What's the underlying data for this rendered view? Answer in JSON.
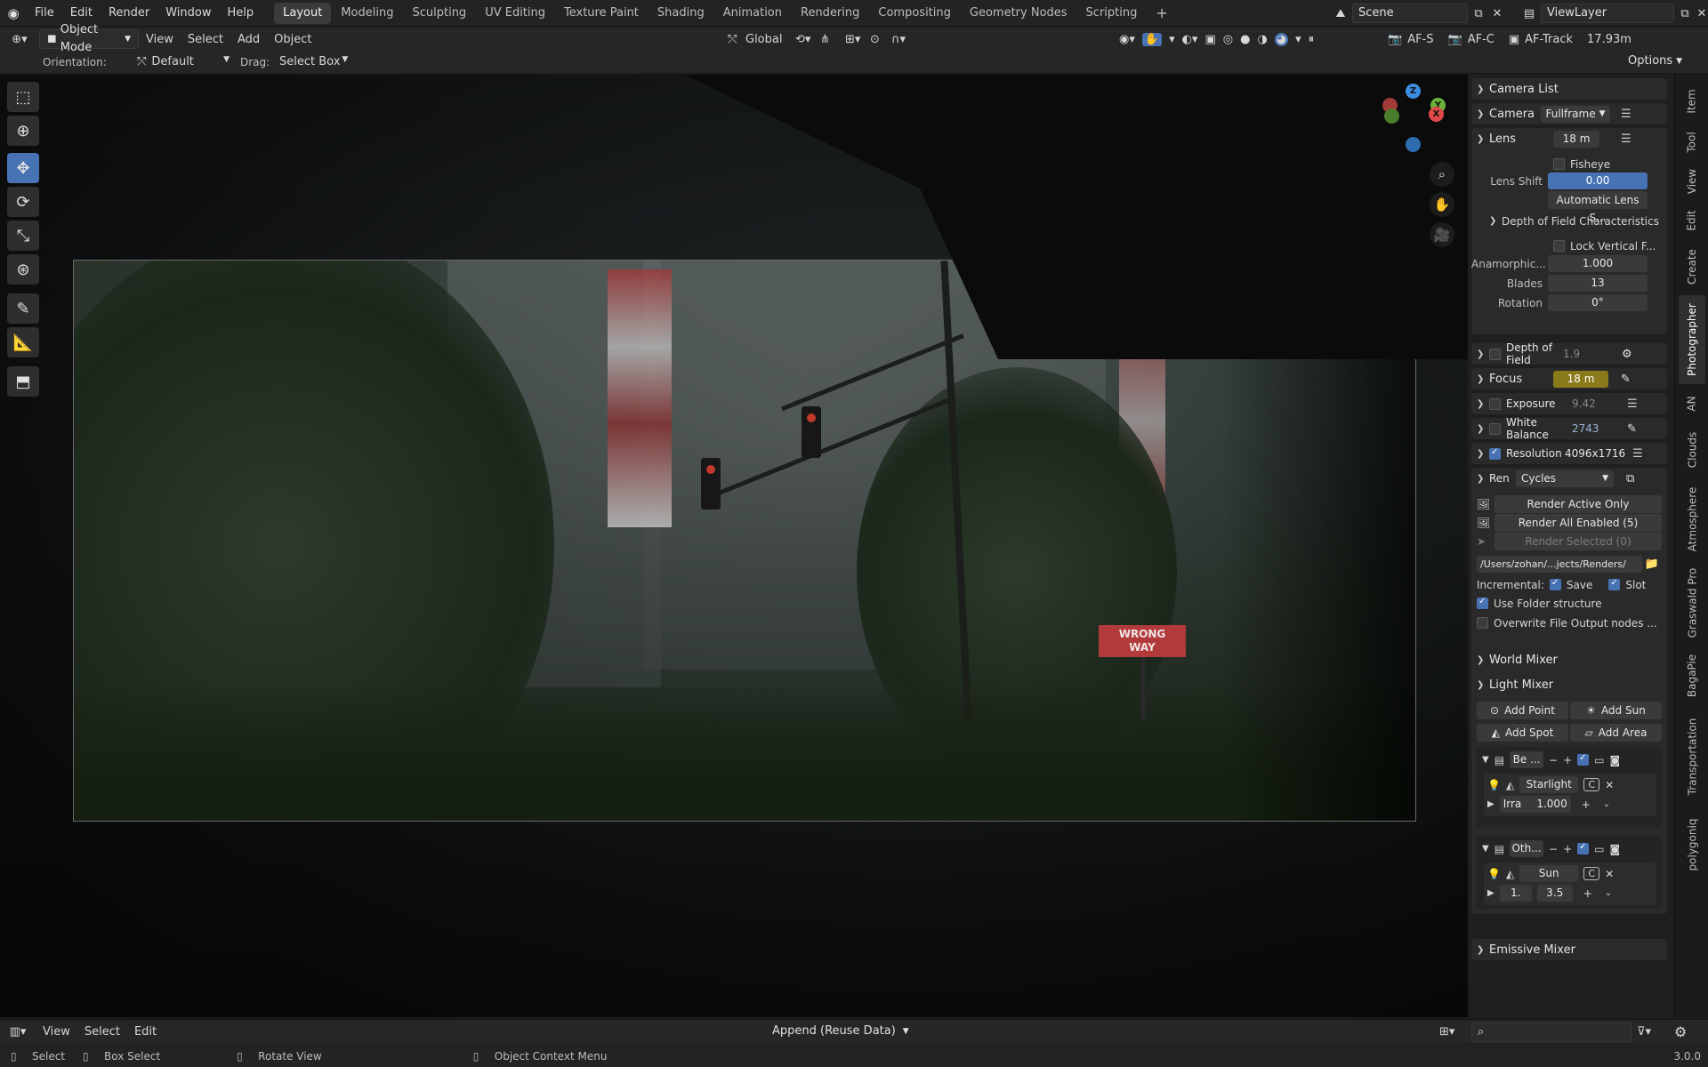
{
  "topbar": {
    "menus": [
      "File",
      "Edit",
      "Render",
      "Window",
      "Help"
    ],
    "workspaces": [
      "Layout",
      "Modeling",
      "Sculpting",
      "UV Editing",
      "Texture Paint",
      "Shading",
      "Animation",
      "Rendering",
      "Compositing",
      "Geometry Nodes",
      "Scripting"
    ],
    "active_workspace": "Layout",
    "add_workspace": "+",
    "scene_name": "Scene",
    "view_layer": "ViewLayer"
  },
  "viewport_header": {
    "mode": "Object Mode",
    "menus": [
      "View",
      "Select",
      "Add",
      "Object"
    ],
    "transform_orientation": "Global",
    "af_s": "AF-S",
    "af_c": "AF-C",
    "af_track": "AF-Track",
    "focus_distance": "17.93m"
  },
  "tool_header": {
    "orientation_label": "Orientation:",
    "orientation_value": "Default",
    "drag_label": "Drag:",
    "drag_value": "Select Box",
    "options_label": "Options"
  },
  "scene": {
    "sign_line1": "WRONG",
    "sign_line2": "WAY"
  },
  "gizmo": {
    "z": "Z",
    "y": "Y",
    "x": "X"
  },
  "sidebar": {
    "camera_list": "Camera List",
    "camera_label": "Camera",
    "camera_value": "Fullframe",
    "lens_label": "Lens",
    "lens_value": "18 m",
    "fisheye": "Fisheye",
    "lens_shift_label": "Lens Shift",
    "lens_shift_value": "0.00",
    "auto_lens_shift": "Automatic Lens S...",
    "dof_characteristics": "Depth of Field Characteristics",
    "lock_vertical": "Lock Vertical F...",
    "anamorphic_label": "Anamorphic...",
    "anamorphic_value": "1.000",
    "blades_label": "Blades",
    "blades_value": "13",
    "rotation_label": "Rotation",
    "rotation_value": "0°",
    "dof_label": "Depth of Field",
    "dof_value": "1.9",
    "focus_label": "Focus",
    "focus_value": "18 m",
    "exposure_label": "Exposure",
    "exposure_value": "9.42",
    "white_balance_label": "White Balance",
    "white_balance_value": "2743",
    "resolution_label": "Resolution",
    "resolution_value": "4096x1716",
    "render_label": "Ren",
    "render_engine": "Cycles",
    "render_active_only": "Render Active Only",
    "render_all_enabled": "Render All Enabled (5)",
    "render_selected": "Render Selected (0)",
    "output_path": "/Users/zohan/...jects/Renders/",
    "incremental_label": "Incremental:",
    "save_label": "Save",
    "slot_label": "Slot",
    "use_folder_structure": "Use Folder structure",
    "overwrite_file_output": "Overwrite File Output nodes ...",
    "world_mixer": "World Mixer",
    "light_mixer": "Light Mixer",
    "add_point": "Add Point",
    "add_sun": "Add Sun",
    "add_spot": "Add Spot",
    "add_area": "Add Area",
    "collection1_name": "Be ...",
    "light1_name": "Starlight ...",
    "light1_c": "C",
    "light1_param_label": "Irra",
    "light1_param_value": "1.000",
    "collection2_name": "Oth...",
    "light2_name": "Sun",
    "light2_c": "C",
    "light2_param_label": "1.",
    "light2_param_value": "3.5",
    "emissive_mixer": "Emissive Mixer",
    "tabs": [
      "Item",
      "Tool",
      "View",
      "Edit",
      "Create",
      "Photographer",
      "AN",
      "Clouds",
      "Atmosphere",
      "Graswald Pro",
      "BagaPie",
      "Transportation",
      "polygoniq"
    ],
    "active_tab": "Photographer"
  },
  "asset_bar": {
    "menus": [
      "View",
      "Select",
      "Edit"
    ],
    "import_method": "Append (Reuse Data)"
  },
  "statusbar": {
    "select": "Select",
    "box_select": "Box Select",
    "rotate_view": "Rotate View",
    "context_menu": "Object Context Menu",
    "version": "3.0.0"
  },
  "colors": {
    "accent_blue": "#4772b3",
    "focus_yellow": "#8a7a1a",
    "axis_x": "#e04949",
    "axis_y": "#6ab43b",
    "axis_z": "#3c8ce0"
  }
}
